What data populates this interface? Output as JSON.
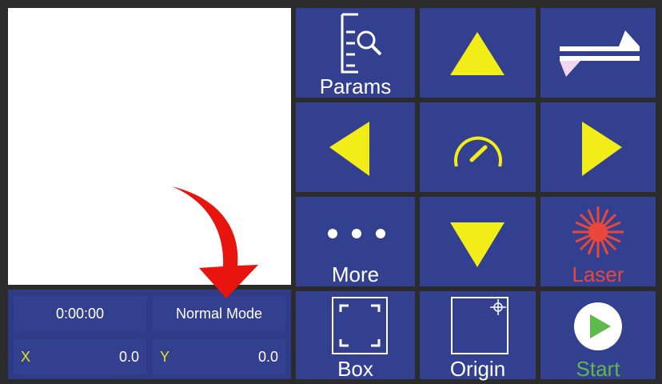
{
  "status": {
    "timer": "0:00:00",
    "mode": "Normal Mode",
    "x_label": "X",
    "x_value": "0.0",
    "y_label": "Y",
    "y_value": "0.0"
  },
  "buttons": {
    "params": "Params",
    "more": "More",
    "laser": "Laser",
    "box": "Box",
    "origin": "Origin",
    "start": "Start"
  },
  "icons": {
    "params": "params-search-icon",
    "up": "arrow-up-icon",
    "swap": "swap-direction-icon",
    "left": "arrow-left-icon",
    "speed": "speedometer-icon",
    "right": "arrow-right-icon",
    "more": "more-dots-icon",
    "down": "arrow-down-icon",
    "laser": "laser-burst-icon",
    "box": "frame-box-icon",
    "origin": "origin-crosshair-icon",
    "start": "play-icon",
    "annotation": "red-curved-arrow"
  },
  "colors": {
    "panel_bg": "#2b2b2b",
    "button_bg": "#33408f",
    "status_bg": "#2f3b86",
    "arrow_yellow": "#f2ec18",
    "laser_red": "#e8473b",
    "start_green": "#5fb84a",
    "axis_yellow": "#e9e21f",
    "annotation_red": "#e8140e"
  }
}
